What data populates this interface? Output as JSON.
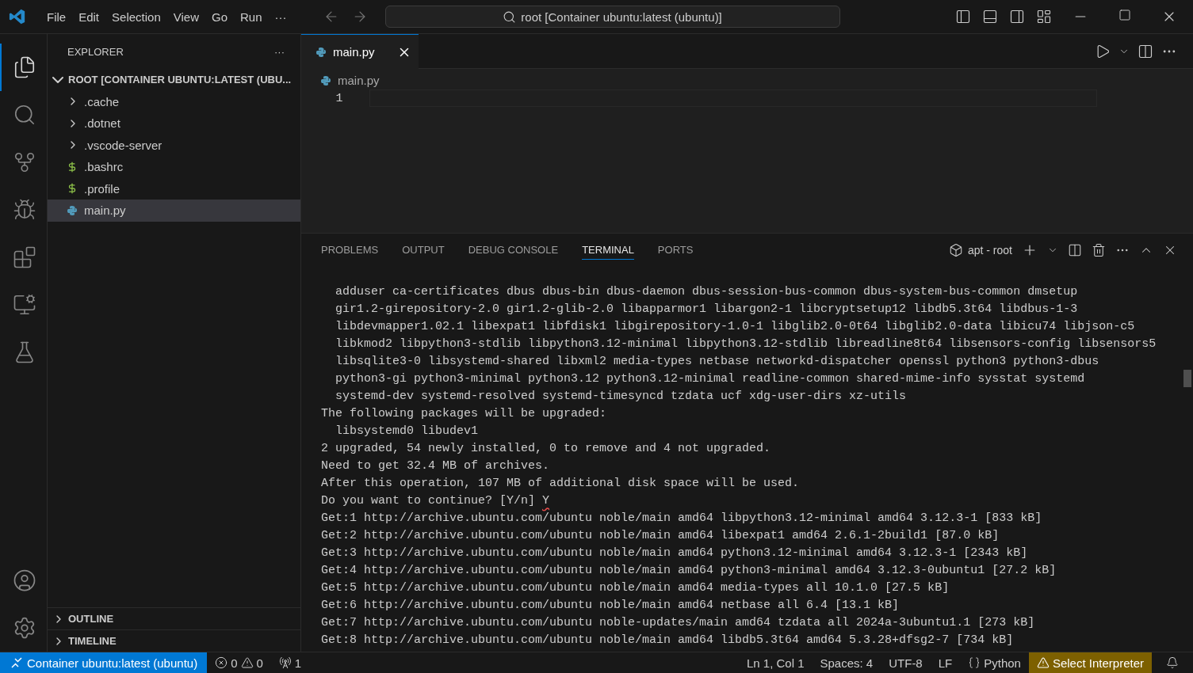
{
  "menu": [
    "File",
    "Edit",
    "Selection",
    "View",
    "Go",
    "Run",
    "···"
  ],
  "command_center": {
    "text": "root [Container ubuntu:latest (ubuntu)]"
  },
  "activity_bar": [
    {
      "kind": "explorer",
      "selected": true
    },
    {
      "kind": "search",
      "selected": false
    },
    {
      "kind": "source-control",
      "selected": false
    },
    {
      "kind": "run-debug",
      "selected": false
    },
    {
      "kind": "extensions",
      "selected": false
    },
    {
      "kind": "remote",
      "selected": false
    },
    {
      "kind": "testing",
      "selected": false
    }
  ],
  "sidebar": {
    "title": "EXPLORER",
    "more": "···",
    "root": {
      "label": "ROOT [CONTAINER UBUNTU:LATEST (UBU...",
      "expanded": true
    },
    "items": [
      {
        "label": ".cache",
        "kind": "folder",
        "expanded": false,
        "selected": false
      },
      {
        "label": ".dotnet",
        "kind": "folder",
        "expanded": false,
        "selected": false
      },
      {
        "label": ".vscode-server",
        "kind": "folder",
        "expanded": false,
        "selected": false
      },
      {
        "label": ".bashrc",
        "kind": "shell",
        "selected": false
      },
      {
        "label": ".profile",
        "kind": "shell",
        "selected": false
      },
      {
        "label": "main.py",
        "kind": "python",
        "selected": true
      }
    ],
    "sections": [
      {
        "label": "OUTLINE",
        "expanded": false
      },
      {
        "label": "TIMELINE",
        "expanded": false
      }
    ]
  },
  "editor": {
    "tabs": [
      {
        "label": "main.py",
        "selected": true
      }
    ],
    "breadcrumb": "main.py",
    "lines": [
      "1"
    ]
  },
  "panel": {
    "tabs": [
      {
        "label": "PROBLEMS",
        "selected": false
      },
      {
        "label": "OUTPUT",
        "selected": false
      },
      {
        "label": "DEBUG CONSOLE",
        "selected": false
      },
      {
        "label": "TERMINAL",
        "selected": true
      },
      {
        "label": "PORTS",
        "selected": false
      }
    ],
    "terminal_name": "apt - root",
    "lines": [
      {
        "text": "  adduser ca-certificates dbus dbus-bin dbus-daemon dbus-session-bus-common dbus-system-bus-common dmsetup"
      },
      {
        "text": "  gir1.2-girepository-2.0 gir1.2-glib-2.0 libapparmor1 libargon2-1 libcryptsetup12 libdb5.3t64 libdbus-1-3"
      },
      {
        "text": "  libdevmapper1.02.1 libexpat1 libfdisk1 libgirepository-1.0-1 libglib2.0-0t64 libglib2.0-data libicu74 libjson-c5"
      },
      {
        "text": "  libkmod2 libpython3-stdlib libpython3.12-minimal libpython3.12-stdlib libreadline8t64 libsensors-config libsensors5"
      },
      {
        "text": "  libsqlite3-0 libsystemd-shared libxml2 media-types netbase networkd-dispatcher openssl python3 python3-dbus"
      },
      {
        "text": "  python3-gi python3-minimal python3.12 python3.12-minimal readline-common shared-mime-info sysstat systemd"
      },
      {
        "text": "  systemd-dev systemd-resolved systemd-timesyncd tzdata ucf xdg-user-dirs xz-utils"
      },
      {
        "text": "The following packages will be upgraded:"
      },
      {
        "text": "  libsystemd0 libudev1"
      },
      {
        "text": "2 upgraded, 54 newly installed, 0 to remove and 4 not upgraded."
      },
      {
        "text": "Need to get 32.4 MB of archives."
      },
      {
        "text": "After this operation, 107 MB of additional disk space will be used."
      },
      {
        "text": "Do you want to continue? [Y/n]",
        "input": "Y"
      },
      {
        "text": "Get:1 http://archive.ubuntu.com/ubuntu noble/main amd64 libpython3.12-minimal amd64 3.12.3-1 [833 kB]"
      },
      {
        "text": "Get:2 http://archive.ubuntu.com/ubuntu noble/main amd64 libexpat1 amd64 2.6.1-2build1 [87.0 kB]"
      },
      {
        "text": "Get:3 http://archive.ubuntu.com/ubuntu noble/main amd64 python3.12-minimal amd64 3.12.3-1 [2343 kB]"
      },
      {
        "text": "Get:4 http://archive.ubuntu.com/ubuntu noble/main amd64 python3-minimal amd64 3.12.3-0ubuntu1 [27.2 kB]"
      },
      {
        "text": "Get:5 http://archive.ubuntu.com/ubuntu noble/main amd64 media-types all 10.1.0 [27.5 kB]"
      },
      {
        "text": "Get:6 http://archive.ubuntu.com/ubuntu noble/main amd64 netbase all 6.4 [13.1 kB]"
      },
      {
        "text": "Get:7 http://archive.ubuntu.com/ubuntu noble-updates/main amd64 tzdata all 2024a-3ubuntu1.1 [273 kB]"
      },
      {
        "text": "Get:8 http://archive.ubuntu.com/ubuntu noble/main amd64 libdb5.3t64 amd64 5.3.28+dfsg2-7 [734 kB]"
      }
    ]
  },
  "status_bar": {
    "remote": "Container ubuntu:latest (ubuntu)",
    "errors": "0",
    "warnings": "0",
    "ports": "1",
    "right": [
      {
        "kind": "text",
        "label": "Ln 1, Col 1"
      },
      {
        "kind": "text",
        "label": "Spaces: 4"
      },
      {
        "kind": "text",
        "label": "UTF-8"
      },
      {
        "kind": "text",
        "label": "LF"
      },
      {
        "kind": "language",
        "label": "Python"
      },
      {
        "kind": "warning",
        "label": "Select Interpreter"
      },
      {
        "kind": "bell"
      }
    ]
  }
}
